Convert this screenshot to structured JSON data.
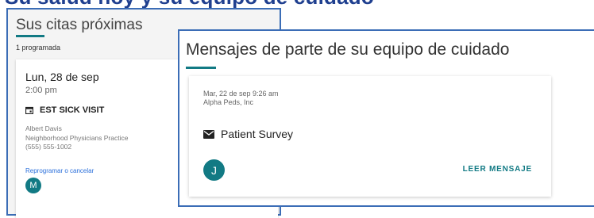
{
  "page_header": {
    "cut_text": "Su salud hoy y su equipo de cuidado"
  },
  "appointments": {
    "title": "Sus citas próximas",
    "count_label": "1 programada",
    "card": {
      "date": "Lun, 28 de sep",
      "time": "2:00 pm",
      "visit_type": "EST SICK VISIT",
      "provider": "Albert Davis",
      "practice": "Neighborhood Physicians Practice",
      "phone": "(555) 555-1002",
      "reschedule_link": "Reprogramar o cancelar",
      "avatar_initial": "M"
    }
  },
  "messages": {
    "title": "Mensajes de parte de su equipo de cuidado",
    "card": {
      "datetime": "Mar, 22 de sep 9:26 am",
      "sender": "Alpha Peds, Inc",
      "subject": "Patient Survey",
      "avatar_initial": "J",
      "read_label": "LEER MENSAJE"
    }
  },
  "colors": {
    "accent": "#127a84",
    "border_highlight": "#3b6db6",
    "link": "#2a6fdb"
  },
  "icons": {
    "visit": "calendar-icon",
    "message": "envelope-icon"
  }
}
